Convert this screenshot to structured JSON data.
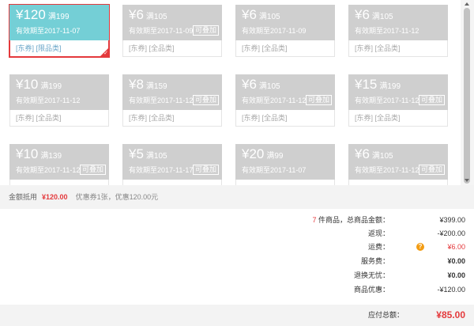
{
  "coupons": [
    {
      "amount": "¥120",
      "condition": "满199",
      "expire": "有效期至2017-11-07",
      "tags": "[东券]  [限品类]",
      "stack": "",
      "selected": true
    },
    {
      "amount": "¥6",
      "condition": "满105",
      "expire": "有效期至2017-11-09",
      "tags": "[东券]  [全品类]",
      "stack": "可叠加",
      "selected": false
    },
    {
      "amount": "¥6",
      "condition": "满105",
      "expire": "有效期至2017-11-09",
      "tags": "[东券]  [全品类]",
      "stack": "",
      "selected": false
    },
    {
      "amount": "¥6",
      "condition": "满105",
      "expire": "有效期至2017-11-12",
      "tags": "[东券]  [全品类]",
      "stack": "",
      "selected": false
    },
    {
      "amount": "¥10",
      "condition": "满199",
      "expire": "有效期至2017-11-12",
      "tags": "[东券]  [全品类]",
      "stack": "",
      "selected": false
    },
    {
      "amount": "¥8",
      "condition": "满159",
      "expire": "有效期至2017-11-12",
      "tags": "[东券]  [全品类]",
      "stack": "可叠加",
      "selected": false
    },
    {
      "amount": "¥6",
      "condition": "满105",
      "expire": "有效期至2017-11-12",
      "tags": "[东券]  [全品类]",
      "stack": "可叠加",
      "selected": false
    },
    {
      "amount": "¥15",
      "condition": "满199",
      "expire": "有效期至2017-11-12",
      "tags": "[东券]  [全品类]",
      "stack": "可叠加",
      "selected": false
    },
    {
      "amount": "¥10",
      "condition": "满139",
      "expire": "有效期至2017-11-12",
      "tags": "",
      "stack": "可叠加",
      "selected": false
    },
    {
      "amount": "¥5",
      "condition": "满105",
      "expire": "有效期至2017-11-17",
      "tags": "",
      "stack": "可叠加",
      "selected": false
    },
    {
      "amount": "¥20",
      "condition": "满99",
      "expire": "有效期至2017-11-07",
      "tags": "",
      "stack": "",
      "selected": false
    },
    {
      "amount": "¥6",
      "condition": "满105",
      "expire": "有效期至2017-11-12",
      "tags": "",
      "stack": "可叠加",
      "selected": false
    }
  ],
  "deduct": {
    "label": "金额抵用",
    "amount": "¥120.00",
    "detail": "优惠券1张，优惠120.00元"
  },
  "summary": {
    "items_count": "7",
    "items_label": "件商品，总商品金额：",
    "items_value": "¥399.00",
    "rebate_label": "返现：",
    "rebate_value": "-¥200.00",
    "freight_label": "运费：",
    "freight_value": "¥6.00",
    "service_label": "服务费：",
    "service_value": "¥0.00",
    "return_label": "退换无忧：",
    "return_value": "¥0.00",
    "discount_label": "商品优惠：",
    "discount_value": "-¥120.00"
  },
  "total": {
    "label": "应付总额：",
    "value": "¥85.00"
  },
  "colors": {
    "accent_red": "#e4393c",
    "selected_coupon": "#74cfd6",
    "disabled_coupon": "#cfcfcf"
  }
}
